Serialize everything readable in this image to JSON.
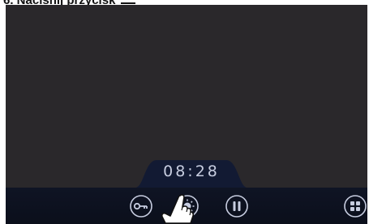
{
  "instruction": {
    "text": "6. Naciśnij przycisk"
  },
  "screen": {
    "timer": "08:28"
  },
  "toolbar": {
    "buttons": [
      {
        "icon": "key-icon"
      },
      {
        "icon": "brightness-icon"
      },
      {
        "icon": "pause-icon"
      },
      {
        "icon": "menu-grid-icon"
      }
    ]
  },
  "colors": {
    "screen_bg": "#2a282b",
    "bar_bg": "#0f1424",
    "tab_bg": "#121a33",
    "icon_stroke": "#c7cde0"
  }
}
